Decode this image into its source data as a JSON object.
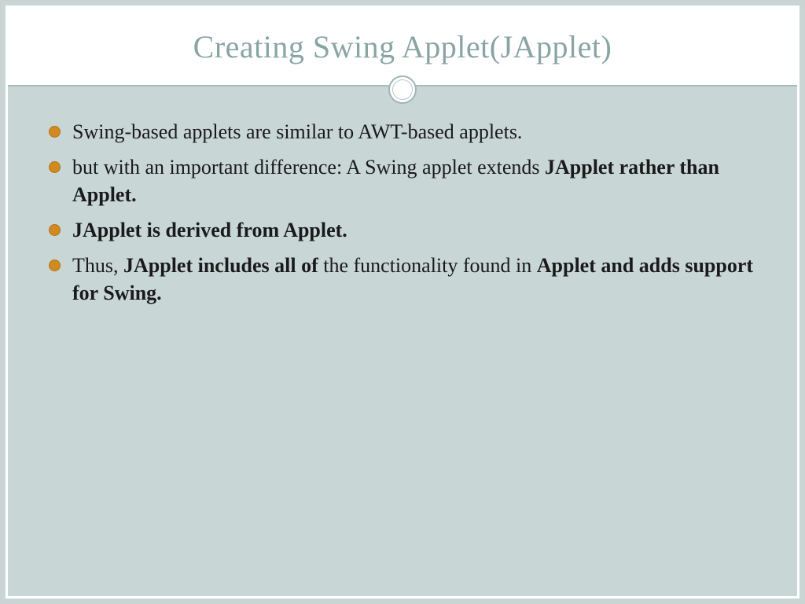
{
  "slide": {
    "title": "Creating Swing Applet(JApplet)",
    "bullets": [
      {
        "segments": [
          {
            "text": "Swing-based applets are similar to AWT-based applets.",
            "bold": false
          }
        ]
      },
      {
        "segments": [
          {
            "text": "but with an important difference: A Swing applet extends ",
            "bold": false
          },
          {
            "text": "JApplet rather than Applet.",
            "bold": true
          }
        ]
      },
      {
        "segments": [
          {
            "text": "JApplet is derived from Applet.",
            "bold": true
          }
        ]
      },
      {
        "segments": [
          {
            "text": "Thus, ",
            "bold": false
          },
          {
            "text": "JApplet includes all of ",
            "bold": true
          },
          {
            "text": "the functionality found in ",
            "bold": false
          },
          {
            "text": "Applet and adds support for Swing.",
            "bold": true
          }
        ]
      }
    ]
  }
}
